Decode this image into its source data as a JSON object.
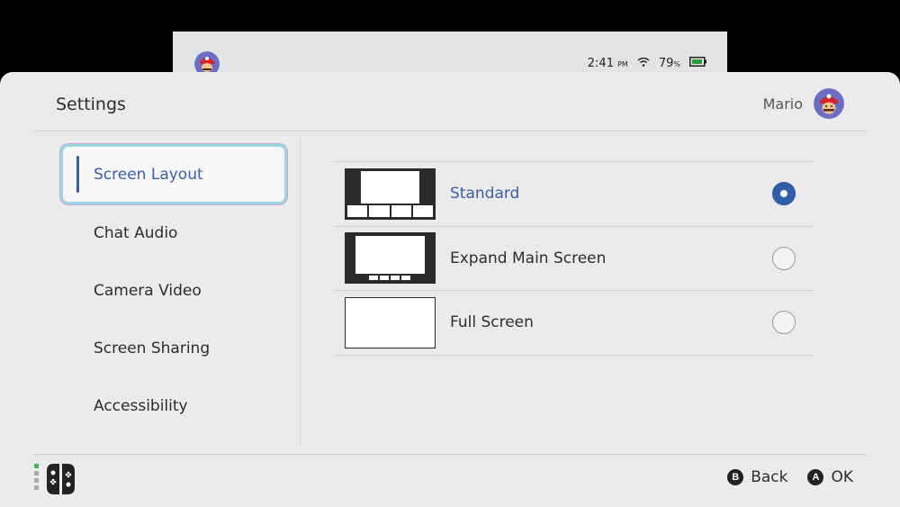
{
  "background": {
    "status": {
      "time": "2:41",
      "time_suffix": "PM",
      "battery": "79",
      "battery_suffix": "%"
    }
  },
  "header": {
    "title": "Settings",
    "user_name": "Mario"
  },
  "sidebar": {
    "items": [
      {
        "label": "Screen Layout",
        "selected": true
      },
      {
        "label": "Chat Audio"
      },
      {
        "label": "Camera Video"
      },
      {
        "label": "Screen Sharing"
      },
      {
        "label": "Accessibility"
      }
    ]
  },
  "options": [
    {
      "label": "Standard",
      "thumbnail": "standard-layout-thumbnail",
      "selected": true
    },
    {
      "label": "Expand Main Screen",
      "thumbnail": "expand-main-screen-thumbnail",
      "selected": false
    },
    {
      "label": "Full Screen",
      "thumbnail": "full-screen-thumbnail",
      "selected": false
    }
  ],
  "footer": {
    "back": {
      "button": "B",
      "label": "Back"
    },
    "ok": {
      "button": "A",
      "label": "OK"
    }
  },
  "colors": {
    "accent": "#3b5ea8",
    "radio_selected": "#2f5da8",
    "panel_bg": "#ebebeb",
    "highlight_border": "#9bd7e3"
  }
}
